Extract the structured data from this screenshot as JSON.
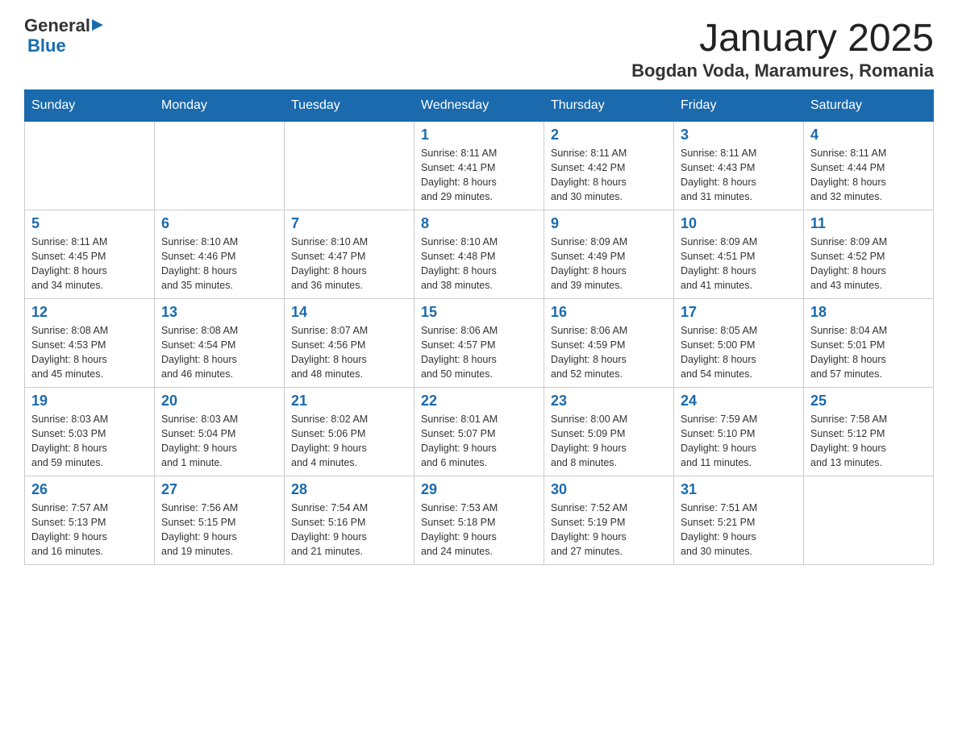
{
  "header": {
    "logo": {
      "general": "General",
      "blue": "Blue",
      "aria": "GeneralBlue Logo"
    },
    "title": "January 2025",
    "subtitle": "Bogdan Voda, Maramures, Romania"
  },
  "days_of_week": [
    "Sunday",
    "Monday",
    "Tuesday",
    "Wednesday",
    "Thursday",
    "Friday",
    "Saturday"
  ],
  "weeks": [
    [
      {
        "day": "",
        "info": ""
      },
      {
        "day": "",
        "info": ""
      },
      {
        "day": "",
        "info": ""
      },
      {
        "day": "1",
        "info": "Sunrise: 8:11 AM\nSunset: 4:41 PM\nDaylight: 8 hours\nand 29 minutes."
      },
      {
        "day": "2",
        "info": "Sunrise: 8:11 AM\nSunset: 4:42 PM\nDaylight: 8 hours\nand 30 minutes."
      },
      {
        "day": "3",
        "info": "Sunrise: 8:11 AM\nSunset: 4:43 PM\nDaylight: 8 hours\nand 31 minutes."
      },
      {
        "day": "4",
        "info": "Sunrise: 8:11 AM\nSunset: 4:44 PM\nDaylight: 8 hours\nand 32 minutes."
      }
    ],
    [
      {
        "day": "5",
        "info": "Sunrise: 8:11 AM\nSunset: 4:45 PM\nDaylight: 8 hours\nand 34 minutes."
      },
      {
        "day": "6",
        "info": "Sunrise: 8:10 AM\nSunset: 4:46 PM\nDaylight: 8 hours\nand 35 minutes."
      },
      {
        "day": "7",
        "info": "Sunrise: 8:10 AM\nSunset: 4:47 PM\nDaylight: 8 hours\nand 36 minutes."
      },
      {
        "day": "8",
        "info": "Sunrise: 8:10 AM\nSunset: 4:48 PM\nDaylight: 8 hours\nand 38 minutes."
      },
      {
        "day": "9",
        "info": "Sunrise: 8:09 AM\nSunset: 4:49 PM\nDaylight: 8 hours\nand 39 minutes."
      },
      {
        "day": "10",
        "info": "Sunrise: 8:09 AM\nSunset: 4:51 PM\nDaylight: 8 hours\nand 41 minutes."
      },
      {
        "day": "11",
        "info": "Sunrise: 8:09 AM\nSunset: 4:52 PM\nDaylight: 8 hours\nand 43 minutes."
      }
    ],
    [
      {
        "day": "12",
        "info": "Sunrise: 8:08 AM\nSunset: 4:53 PM\nDaylight: 8 hours\nand 45 minutes."
      },
      {
        "day": "13",
        "info": "Sunrise: 8:08 AM\nSunset: 4:54 PM\nDaylight: 8 hours\nand 46 minutes."
      },
      {
        "day": "14",
        "info": "Sunrise: 8:07 AM\nSunset: 4:56 PM\nDaylight: 8 hours\nand 48 minutes."
      },
      {
        "day": "15",
        "info": "Sunrise: 8:06 AM\nSunset: 4:57 PM\nDaylight: 8 hours\nand 50 minutes."
      },
      {
        "day": "16",
        "info": "Sunrise: 8:06 AM\nSunset: 4:59 PM\nDaylight: 8 hours\nand 52 minutes."
      },
      {
        "day": "17",
        "info": "Sunrise: 8:05 AM\nSunset: 5:00 PM\nDaylight: 8 hours\nand 54 minutes."
      },
      {
        "day": "18",
        "info": "Sunrise: 8:04 AM\nSunset: 5:01 PM\nDaylight: 8 hours\nand 57 minutes."
      }
    ],
    [
      {
        "day": "19",
        "info": "Sunrise: 8:03 AM\nSunset: 5:03 PM\nDaylight: 8 hours\nand 59 minutes."
      },
      {
        "day": "20",
        "info": "Sunrise: 8:03 AM\nSunset: 5:04 PM\nDaylight: 9 hours\nand 1 minute."
      },
      {
        "day": "21",
        "info": "Sunrise: 8:02 AM\nSunset: 5:06 PM\nDaylight: 9 hours\nand 4 minutes."
      },
      {
        "day": "22",
        "info": "Sunrise: 8:01 AM\nSunset: 5:07 PM\nDaylight: 9 hours\nand 6 minutes."
      },
      {
        "day": "23",
        "info": "Sunrise: 8:00 AM\nSunset: 5:09 PM\nDaylight: 9 hours\nand 8 minutes."
      },
      {
        "day": "24",
        "info": "Sunrise: 7:59 AM\nSunset: 5:10 PM\nDaylight: 9 hours\nand 11 minutes."
      },
      {
        "day": "25",
        "info": "Sunrise: 7:58 AM\nSunset: 5:12 PM\nDaylight: 9 hours\nand 13 minutes."
      }
    ],
    [
      {
        "day": "26",
        "info": "Sunrise: 7:57 AM\nSunset: 5:13 PM\nDaylight: 9 hours\nand 16 minutes."
      },
      {
        "day": "27",
        "info": "Sunrise: 7:56 AM\nSunset: 5:15 PM\nDaylight: 9 hours\nand 19 minutes."
      },
      {
        "day": "28",
        "info": "Sunrise: 7:54 AM\nSunset: 5:16 PM\nDaylight: 9 hours\nand 21 minutes."
      },
      {
        "day": "29",
        "info": "Sunrise: 7:53 AM\nSunset: 5:18 PM\nDaylight: 9 hours\nand 24 minutes."
      },
      {
        "day": "30",
        "info": "Sunrise: 7:52 AM\nSunset: 5:19 PM\nDaylight: 9 hours\nand 27 minutes."
      },
      {
        "day": "31",
        "info": "Sunrise: 7:51 AM\nSunset: 5:21 PM\nDaylight: 9 hours\nand 30 minutes."
      },
      {
        "day": "",
        "info": ""
      }
    ]
  ]
}
